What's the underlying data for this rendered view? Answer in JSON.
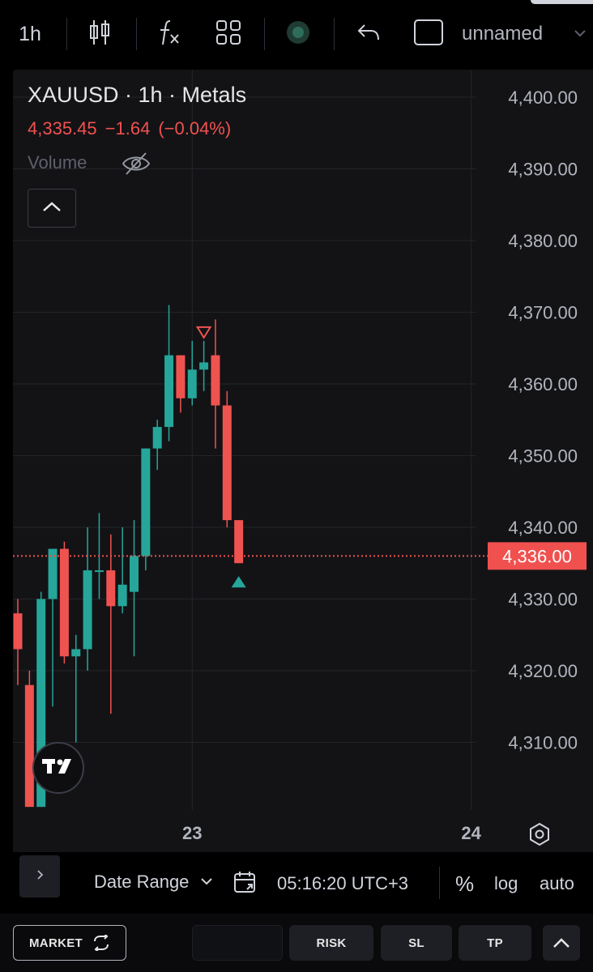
{
  "toolbar": {
    "timeframe": "1h",
    "layout_name": "unnamed"
  },
  "legend": {
    "title": "XAUUSD · 1h · Metals",
    "price": "4,335.45",
    "change": "−1.64",
    "change_pct": "(−0.04%)",
    "volume_label": "Volume"
  },
  "colors": {
    "up": "#26a69a",
    "down": "#ef5350",
    "background": "#131316",
    "price_line": "#f0514f"
  },
  "price_axis": {
    "labels": [
      "4,400.00",
      "4,390.00",
      "4,380.00",
      "4,370.00",
      "4,360.00",
      "4,350.00",
      "4,340.00",
      "4,330.00",
      "4,320.00",
      "4,310.00"
    ],
    "current_price_label": "4,336.00"
  },
  "time_axis": {
    "labels": [
      "23",
      "24"
    ]
  },
  "chart_data": {
    "type": "candlestick",
    "symbol": "XAUUSD",
    "interval": "1h",
    "ylim": [
      4301.5,
      4403.5
    ],
    "current_price": 4336.0,
    "grid": true,
    "candles": [
      {
        "o": 4328,
        "h": 4330,
        "l": 4318,
        "c": 4323
      },
      {
        "o": 4318,
        "h": 4320,
        "l": 4301,
        "c": 4301
      },
      {
        "o": 4301,
        "h": 4331,
        "l": 4301,
        "c": 4330
      },
      {
        "o": 4330,
        "h": 4337,
        "l": 4315,
        "c": 4337
      },
      {
        "o": 4337,
        "h": 4338,
        "l": 4321,
        "c": 4322
      },
      {
        "o": 4322,
        "h": 4325,
        "l": 4310,
        "c": 4323
      },
      {
        "o": 4323,
        "h": 4340,
        "l": 4320,
        "c": 4334
      },
      {
        "o": 4334,
        "h": 4342,
        "l": 4330,
        "c": 4334
      },
      {
        "o": 4334,
        "h": 4339,
        "l": 4314,
        "c": 4329
      },
      {
        "o": 4329,
        "h": 4340,
        "l": 4328,
        "c": 4332
      },
      {
        "o": 4331,
        "h": 4341,
        "l": 4322,
        "c": 4336
      },
      {
        "o": 4336,
        "h": 4351,
        "l": 4334,
        "c": 4351
      },
      {
        "o": 4351,
        "h": 4355,
        "l": 4348,
        "c": 4354
      },
      {
        "o": 4354,
        "h": 4371,
        "l": 4352,
        "c": 4364
      },
      {
        "o": 4364,
        "h": 4364,
        "l": 4356,
        "c": 4358
      },
      {
        "o": 4358,
        "h": 4366,
        "l": 4357,
        "c": 4362
      },
      {
        "o": 4362,
        "h": 4366,
        "l": 4359,
        "c": 4363
      },
      {
        "o": 4364,
        "h": 4369,
        "l": 4351,
        "c": 4357
      },
      {
        "o": 4357,
        "h": 4359,
        "l": 4340,
        "c": 4341
      },
      {
        "o": 4341,
        "h": 4341,
        "l": 4335,
        "c": 4335
      }
    ],
    "markers": [
      {
        "type": "sell",
        "candle_index": 16
      },
      {
        "type": "buy",
        "candle_index": 19
      }
    ],
    "x_labels": [
      {
        "label": "23",
        "near_candle_index": 15
      },
      {
        "label": "24",
        "near_candle_index": 39
      }
    ]
  },
  "bottombar": {
    "date_range": "Date Range",
    "clock": "05:16:20 UTC+3",
    "percent": "%",
    "log": "log",
    "auto": "auto"
  },
  "tradebar": {
    "market": "MARKET",
    "risk": "RISK",
    "sl": "SL",
    "tp": "TP"
  }
}
